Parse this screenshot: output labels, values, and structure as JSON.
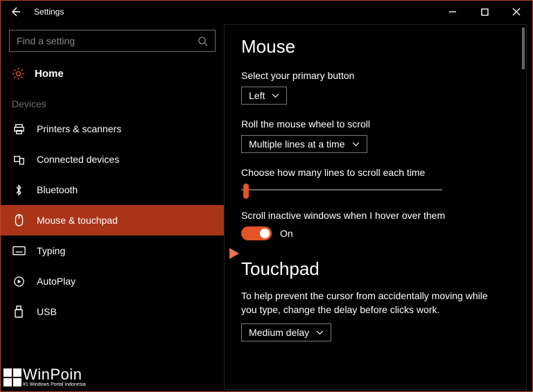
{
  "titlebar": {
    "title": "Settings"
  },
  "sidebar": {
    "search_placeholder": "Find a setting",
    "home_label": "Home",
    "section_label": "Devices",
    "items": [
      {
        "label": "Printers & scanners"
      },
      {
        "label": "Connected devices"
      },
      {
        "label": "Bluetooth"
      },
      {
        "label": "Mouse & touchpad"
      },
      {
        "label": "Typing"
      },
      {
        "label": "AutoPlay"
      },
      {
        "label": "USB"
      }
    ]
  },
  "main": {
    "heading": "Mouse",
    "primary_label": "Select your primary button",
    "primary_value": "Left",
    "scroll_label": "Roll the mouse wheel to scroll",
    "scroll_value": "Multiple lines at a time",
    "lines_label": "Choose how many lines to scroll each time",
    "inactive_label": "Scroll inactive windows when I hover over them",
    "toggle_text": "On",
    "touchpad_heading": "Touchpad",
    "touchpad_desc": "To help prevent the cursor from accidentally moving while you type, change the delay before clicks work.",
    "touchpad_delay": "Medium delay"
  },
  "watermark": {
    "title": "WinPoin",
    "subtitle": "#1 Windows Portal Indonesia"
  },
  "colors": {
    "accent": "#e45426",
    "nav_active": "#aa3417"
  }
}
